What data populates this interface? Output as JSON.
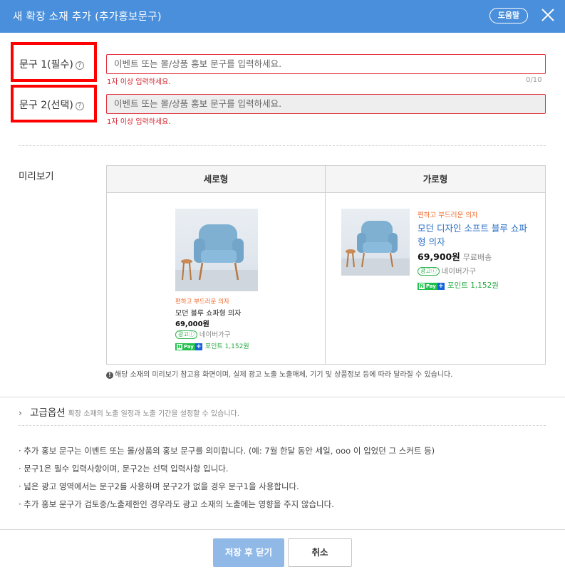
{
  "header": {
    "title": "새 확장 소재 추가 (추가홍보문구)",
    "help_label": "도움말"
  },
  "fields": {
    "text1": {
      "label": "문구 1(필수)",
      "placeholder": "이벤트 또는 몰/상품 홍보 문구를 입력하세요.",
      "error": "1자 이상 입력하세요.",
      "counter": "0/10"
    },
    "text2": {
      "label": "문구 2(선택)",
      "placeholder": "이벤트 또는 몰/상품 홍보 문구를 입력하세요.",
      "error": "1자 이상 입력하세요."
    }
  },
  "preview": {
    "label": "미리보기",
    "vertical": {
      "header": "세로형",
      "promo": "편하고 부드러운 의자",
      "name": "모던 블루 쇼파형 의자",
      "price": "69,000원",
      "ad_badge": "광고ⓘ",
      "seller": "네이버가구",
      "pay_label": "Pay",
      "point": "포인트 1,152원"
    },
    "horizontal": {
      "header": "가로형",
      "promo": "편하고 부드러운 의자",
      "name_line1": "모던 디자인 소프트 블루 쇼파",
      "name_line2": "형 의자",
      "price": "69,900원",
      "shipping": "무료배송",
      "ad_badge": "광고ⓘ",
      "seller": "네이버가구",
      "pay_label": "Pay",
      "point": "포인트 1,152원"
    },
    "notice": "해당 소재의 미리보기 참고용 화면이며, 실제 광고 노출 노출매체, 기기 및 상품정보 등에 따라 달라질 수 있습니다."
  },
  "advanced": {
    "title": "고급옵션",
    "description": "확장 소재의 노출 일정과 노출 기간을 설정할 수 있습니다."
  },
  "info_bullets": [
    "· 추가 홍보 문구는 이벤트 또는 몰/상품의 홍보 문구를 의미합니다. (예: 7월 한달 동안 세일, ooo 이 입었던 그 스커트 등)",
    "· 문구1은 필수 입력사항이며, 문구2는 선택 입력사항 입니다.",
    "· 넓은 광고 영역에서는 문구2를 사용하며 문구2가 없을 경우 문구1을 사용합니다.",
    "· 추가 홍보 문구가 검토중/노출제한인 경우라도 광고 소재의 노출에는 영향을 주지 않습니다."
  ],
  "buttons": {
    "save": "저장 후 닫기",
    "cancel": "취소"
  },
  "colors": {
    "header": "#4a8fdb",
    "error": "#d4202b",
    "highlight_box": "#ff0000",
    "primary_button": "#91b9e8"
  }
}
